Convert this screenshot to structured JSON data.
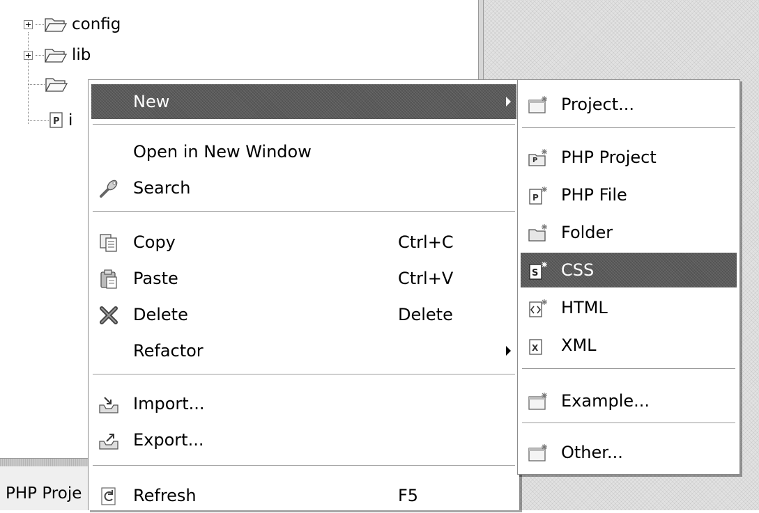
{
  "tree": {
    "items": [
      {
        "label": "config"
      },
      {
        "label": "lib"
      },
      {
        "label": ""
      },
      {
        "label": "i"
      }
    ]
  },
  "status": {
    "text": "PHP Proje"
  },
  "context_menu": {
    "items": [
      {
        "label": "New",
        "shortcut": "",
        "icon": "none",
        "submenu": true,
        "highlighted": true
      },
      {
        "label": "Open in New Window",
        "shortcut": "",
        "icon": "none"
      },
      {
        "label": "Search",
        "shortcut": "",
        "icon": "flashlight-icon"
      },
      {
        "label": "Copy",
        "shortcut": "Ctrl+C",
        "icon": "copy-icon"
      },
      {
        "label": "Paste",
        "shortcut": "Ctrl+V",
        "icon": "paste-icon"
      },
      {
        "label": "Delete",
        "shortcut": "Delete",
        "icon": "delete-x-icon"
      },
      {
        "label": "Refactor",
        "shortcut": "",
        "icon": "none",
        "submenu": true
      },
      {
        "label": "Import...",
        "shortcut": "",
        "icon": "import-icon"
      },
      {
        "label": "Export...",
        "shortcut": "",
        "icon": "export-icon"
      },
      {
        "label": "Refresh",
        "shortcut": "F5",
        "icon": "refresh-icon"
      }
    ]
  },
  "new_submenu": {
    "items": [
      {
        "label": "Project...",
        "icon": "new-project-wizard-icon"
      },
      {
        "label": "PHP Project",
        "icon": "new-php-project-icon"
      },
      {
        "label": "PHP File",
        "icon": "new-php-file-icon"
      },
      {
        "label": "Folder",
        "icon": "new-folder-icon"
      },
      {
        "label": "CSS",
        "icon": "new-css-file-icon",
        "highlighted": true
      },
      {
        "label": "HTML",
        "icon": "new-html-file-icon"
      },
      {
        "label": "XML",
        "icon": "new-xml-file-icon"
      },
      {
        "label": "Example...",
        "icon": "new-example-wizard-icon"
      },
      {
        "label": "Other...",
        "icon": "new-other-wizard-icon"
      }
    ]
  },
  "colors": {
    "highlight": "#5a5a5a",
    "menu_bg": "#ffffff",
    "separator": "#9a9a9a"
  }
}
